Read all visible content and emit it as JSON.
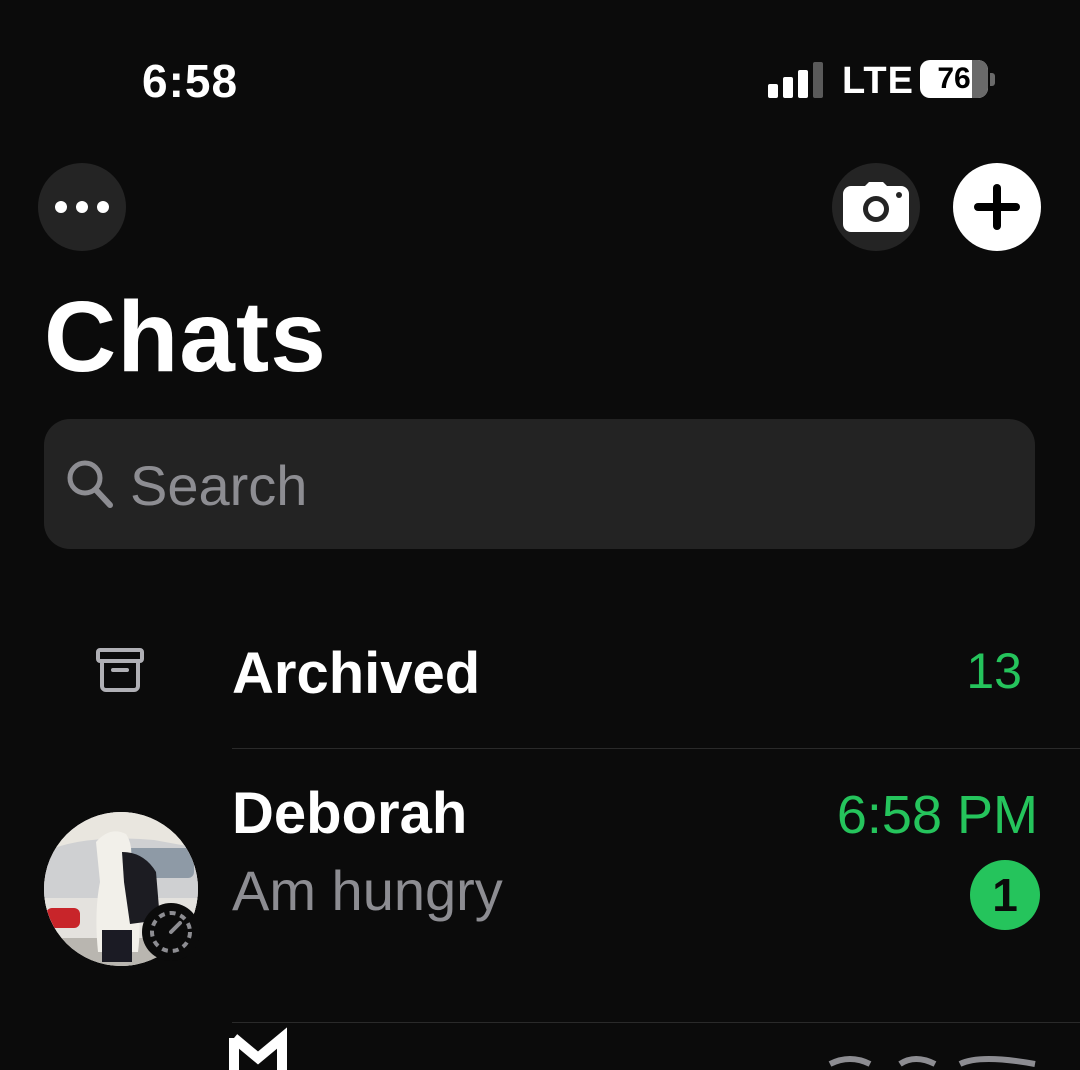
{
  "status_bar": {
    "time": "6:58",
    "network": "LTE",
    "battery_percent": "76",
    "battery_level": 0.76,
    "signal_bars_active": 3,
    "signal_bars_total": 4
  },
  "header": {
    "more_icon": "ellipsis-icon",
    "camera_icon": "camera-icon",
    "new_chat_icon": "plus-icon",
    "title": "Chats"
  },
  "search": {
    "placeholder": "Search",
    "value": "",
    "icon": "search-icon"
  },
  "archived": {
    "label": "Archived",
    "count": "13",
    "icon": "archive-box-icon"
  },
  "chats": [
    {
      "name": "Deborah",
      "time": "6:58 PM",
      "message": "Am hungry",
      "unread_count": "1",
      "has_status": true
    }
  ],
  "colors": {
    "background": "#0b0b0b",
    "accent_green": "#25c45c",
    "secondary_text": "#8d8d92",
    "search_background": "#232323",
    "button_background": "#242424"
  }
}
